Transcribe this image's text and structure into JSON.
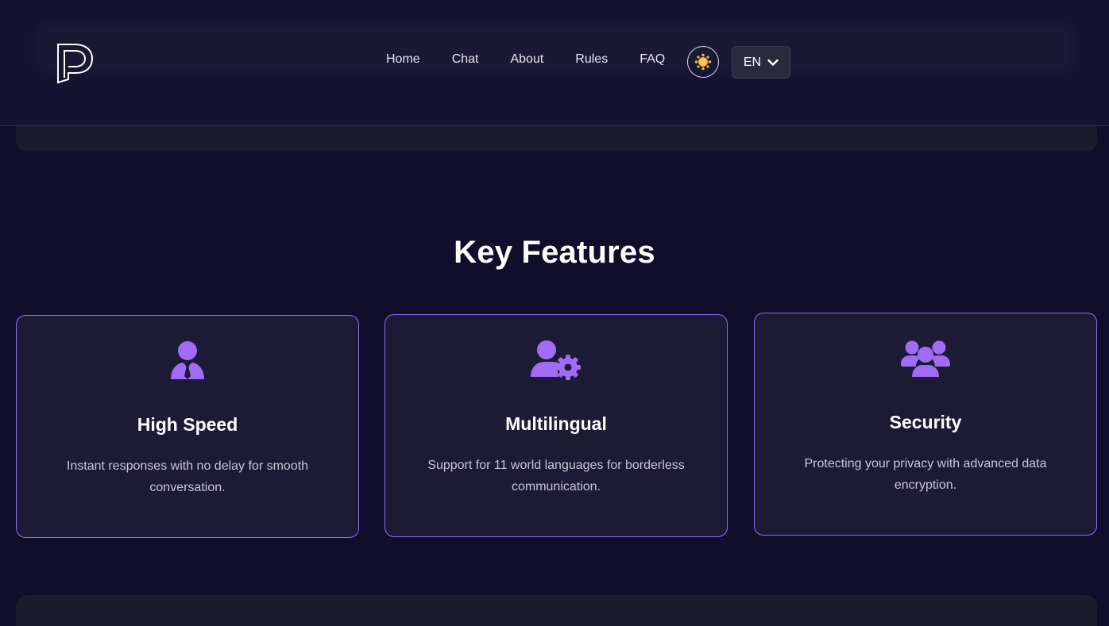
{
  "nav": {
    "items": [
      {
        "label": "Home"
      },
      {
        "label": "Chat"
      },
      {
        "label": "About"
      },
      {
        "label": "Rules"
      },
      {
        "label": "FAQ"
      }
    ],
    "theme_icon": "sun-icon",
    "language": "EN",
    "language_icon": "chevron-down-icon"
  },
  "features": {
    "title": "Key Features",
    "cards": [
      {
        "icon": "user-tie-icon",
        "title": "High Speed",
        "description": "Instant responses with no delay for smooth conversation."
      },
      {
        "icon": "user-gear-icon",
        "title": "Multilingual",
        "description": "Support for 11 world languages for borderless communication."
      },
      {
        "icon": "users-icon",
        "title": "Security",
        "description": "Protecting your privacy with advanced data encryption."
      }
    ]
  },
  "colors": {
    "background": "#100e2b",
    "accent": "#a06cf5",
    "card_border": "#8f6ff0",
    "sun": "#f3b43a"
  }
}
